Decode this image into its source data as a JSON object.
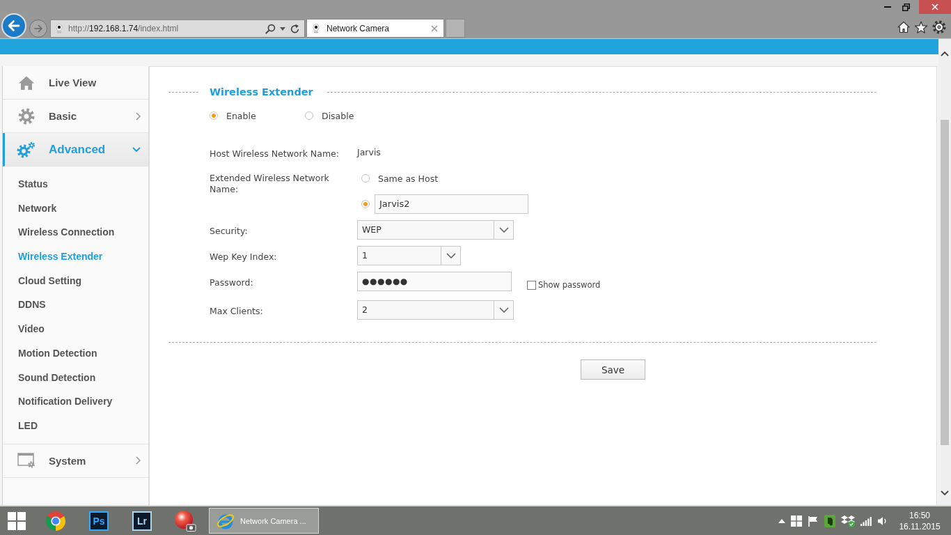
{
  "browser": {
    "url": {
      "scheme": "http://",
      "host": "192.168.1.74",
      "path": "/index.html"
    },
    "tabs": [
      {
        "label": "Network Camera",
        "selected": true
      }
    ]
  },
  "sidebar": {
    "items": [
      {
        "label": "Live View",
        "selected": false
      },
      {
        "label": "Basic",
        "selected": false,
        "expanded": false
      },
      {
        "label": "Advanced",
        "selected": true,
        "expanded": true,
        "children": [
          {
            "label": "Status",
            "selected": false
          },
          {
            "label": "Network",
            "selected": false
          },
          {
            "label": "Wireless Connection",
            "selected": false
          },
          {
            "label": "Wireless Extender",
            "selected": true
          },
          {
            "label": "Cloud Setting",
            "selected": false
          },
          {
            "label": "DDNS",
            "selected": false
          },
          {
            "label": "Video",
            "selected": false
          },
          {
            "label": "Motion Detection",
            "selected": false
          },
          {
            "label": "Sound Detection",
            "selected": false
          },
          {
            "label": "Notification Delivery",
            "selected": false
          },
          {
            "label": "LED",
            "selected": false
          }
        ]
      },
      {
        "label": "System",
        "selected": false,
        "expanded": false
      }
    ]
  },
  "settings": {
    "title": "Wireless Extender",
    "mode_options": [
      {
        "label": "Enable",
        "selected": true
      },
      {
        "label": "Disable",
        "selected": false
      }
    ],
    "fields": [
      {
        "kind": "text",
        "label": "Host Wireless Network Name:",
        "value": "Jarvis"
      },
      {
        "kind": "choice",
        "label": "Extended Wireless Network Name:",
        "options": [
          {
            "kind": "label",
            "label": "Same as Host",
            "selected": false
          },
          {
            "kind": "input",
            "value": "Jarvis2",
            "selected": true
          }
        ]
      },
      {
        "kind": "select",
        "label": "Security:",
        "value": "WEP"
      },
      {
        "kind": "select",
        "label": "Wep Key Index:",
        "value": "1"
      },
      {
        "kind": "password",
        "label": "Password:",
        "value": "●●●●●●",
        "checkbox": {
          "label": "Show password",
          "checked": false
        }
      },
      {
        "kind": "select",
        "label": "Max Clients:",
        "value": "2"
      }
    ],
    "save_button": "Save"
  },
  "taskbar": {
    "apps": [
      {
        "kind": "tricolor"
      },
      {
        "kind": "tile",
        "label": "Ps",
        "color": "#31a8ff"
      },
      {
        "kind": "tile",
        "label": "Lr",
        "color": "#add5ec"
      },
      {
        "kind": "sphere"
      },
      {
        "kind": "window",
        "label": "Network Camera ...",
        "selected": true
      }
    ],
    "clock": {
      "time": "16:50",
      "date": "16.11.2015"
    }
  }
}
